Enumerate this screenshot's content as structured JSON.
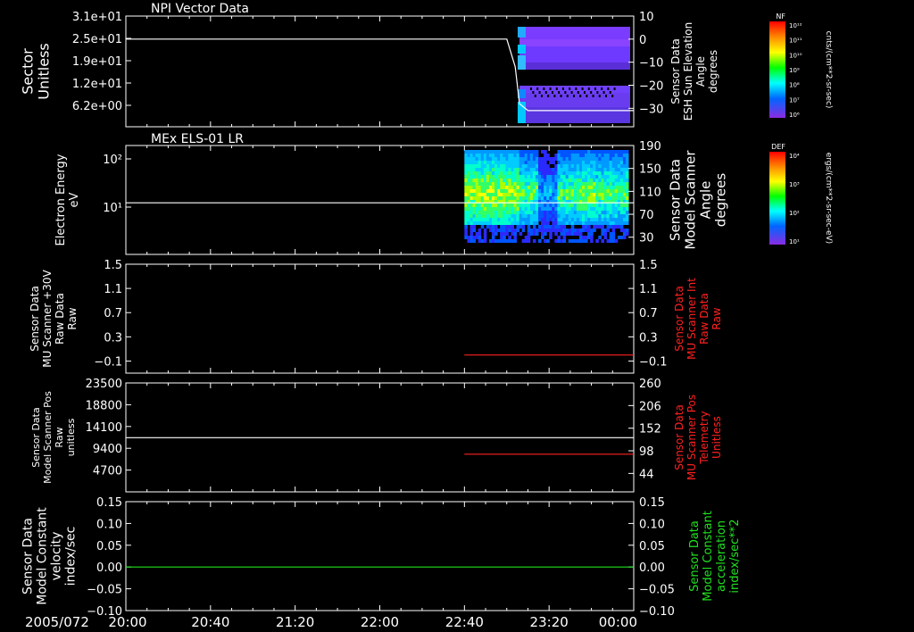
{
  "chart_data": [
    {
      "type": "heatmap",
      "title": "NPI Vector Data",
      "ylabel_left": [
        "Sector",
        "Unitless"
      ],
      "yticks_left": [
        "3.1e+01",
        "2.5e+01",
        "1.9e+01",
        "1.2e+01",
        "6.2e+00"
      ],
      "ylabel_right": [
        "Sensor Data",
        "ESH Sun Elevation",
        "Angle",
        "degrees"
      ],
      "yticks_right": [
        "10",
        "0",
        "−10",
        "−20",
        "−30"
      ],
      "ylim_right": [
        -38,
        10
      ],
      "series": [
        {
          "name": "ESH Sun Elevation Angle",
          "color": "#ffffff",
          "x": [
            "20:00",
            "23:00",
            "23:04",
            "23:06",
            "23:10",
            "00:00"
          ],
          "y": [
            0,
            0,
            -12,
            -28,
            -31,
            -31
          ]
        }
      ],
      "spectrogram": {
        "x_start": "23:06",
        "x_end": "00:00",
        "colormap": "rainbow"
      },
      "colorbar": {
        "label": "NF",
        "ticks": [
          "10¹²",
          "10¹¹",
          "10¹⁰",
          "10⁹",
          "10⁸",
          "10⁷",
          "10⁶"
        ],
        "unit": "cnts/(cm**2-sr-sec)"
      }
    },
    {
      "type": "heatmap",
      "title": "MEx ELS-01 LR",
      "ylabel_left": [
        "Electron Energy",
        "eV"
      ],
      "yticks_left": [
        "10²",
        "10¹"
      ],
      "ylabel_right": [
        "Sensor Data",
        "Model Scanner",
        "Angle",
        "degrees"
      ],
      "yticks_right": [
        "190",
        "150",
        "110",
        "70",
        "30"
      ],
      "ylim_right": [
        0,
        190
      ],
      "series": [
        {
          "name": "Model Scanner Angle",
          "color": "#ffffff",
          "x": [
            "20:00",
            "00:00"
          ],
          "y": [
            90,
            90
          ]
        }
      ],
      "spectrogram": {
        "x_start": "22:40",
        "x_end": "00:00",
        "colormap": "rainbow"
      },
      "colorbar": {
        "label": "DEF",
        "ticks": [
          "10⁴",
          "10³",
          "10²",
          "10¹"
        ],
        "unit": "ergs/(cm**2-sr-sec-eV)"
      }
    },
    {
      "type": "line",
      "ylabel_left": [
        "Sensor Data",
        "MU Scanner +30V",
        "Raw Data",
        "Raw"
      ],
      "yticks_left": [
        "1.5",
        "1.1",
        "0.7",
        "0.3",
        "−0.1"
      ],
      "ylabel_right": [
        "Sensor Data",
        "MU Scanner Int",
        "Raw Data",
        "Raw"
      ],
      "yticks_right": [
        "1.5",
        "1.1",
        "0.7",
        "0.3",
        "−0.1"
      ],
      "ylim": [
        -0.3,
        1.5
      ],
      "series": [
        {
          "name": "MU Scanner Int Raw Data",
          "color": "#ff2020",
          "x": [
            "22:40",
            "00:00"
          ],
          "y": [
            0.0,
            0.0
          ]
        }
      ]
    },
    {
      "type": "line",
      "ylabel_left": [
        "Sensor Data",
        "Model Scanner Pos",
        "Raw",
        "unitless"
      ],
      "yticks_left": [
        "23500",
        "18800",
        "14100",
        "9400",
        "4700"
      ],
      "ylabel_right": [
        "Sensor Data",
        "MU Scanner Pos",
        "Telemetry",
        "Unitless"
      ],
      "yticks_right": [
        "260",
        "206",
        "152",
        "98",
        "44"
      ],
      "ylim_left": [
        0,
        23500
      ],
      "ylim_right": [
        0,
        260
      ],
      "series": [
        {
          "name": "Model Scanner Pos Raw",
          "color": "#ffffff",
          "axis": "left",
          "x": [
            "20:00",
            "00:00"
          ],
          "y": [
            11700,
            11700
          ]
        },
        {
          "name": "MU Scanner Pos Telemetry",
          "color": "#ff2020",
          "axis": "right",
          "x": [
            "22:40",
            "00:00"
          ],
          "y": [
            90,
            90
          ]
        }
      ]
    },
    {
      "type": "line",
      "ylabel_left": [
        "Sensor Data",
        "Model Constant",
        "velocity",
        "index/sec"
      ],
      "yticks_left": [
        "0.15",
        "0.10",
        "0.05",
        "0.00",
        "−0.05",
        "−0.10"
      ],
      "ylabel_right": [
        "Sensor Data",
        "Model Constant",
        "acceleration",
        "index/sec**2"
      ],
      "yticks_right": [
        "0.15",
        "0.10",
        "0.05",
        "0.00",
        "−0.05",
        "−0.10"
      ],
      "ylim": [
        -0.1,
        0.15
      ],
      "series": [
        {
          "name": "Model Constant acceleration",
          "color": "#20e020",
          "x": [
            "20:00",
            "00:00"
          ],
          "y": [
            0.0,
            0.0
          ]
        }
      ]
    }
  ],
  "x_axis": {
    "date_label": "2005/072",
    "ticks": [
      "20:00",
      "20:40",
      "21:20",
      "22:00",
      "22:40",
      "23:20",
      "00:00"
    ],
    "range": [
      "20:00",
      "00:00"
    ]
  },
  "colors": {
    "white": "#ffffff",
    "red": "#ff2020",
    "green": "#20e020",
    "background": "#000000"
  }
}
